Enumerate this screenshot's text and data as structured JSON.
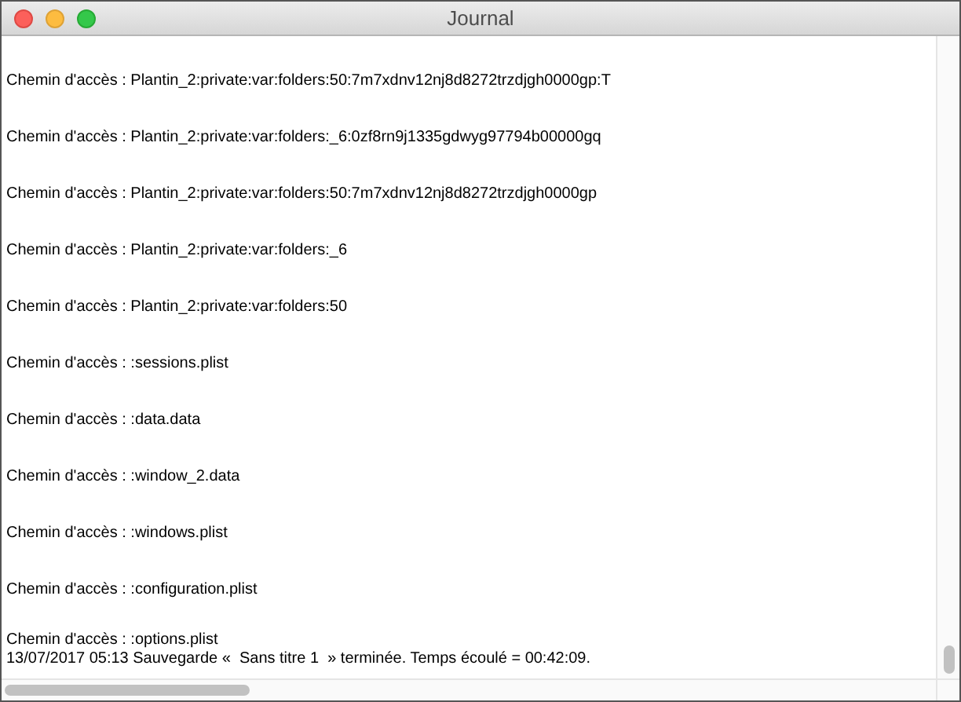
{
  "window": {
    "title": "Journal"
  },
  "log_lines": [
    "Chemin d'accès : Plantin_2:private:var:folders:50:7m7xdnv12nj8d8272trzdjgh0000gp:T",
    "Chemin d'accès : Plantin_2:private:var:folders:_6:0zf8rn9j1335gdwyg97794b00000gq",
    "Chemin d'accès : Plantin_2:private:var:folders:50:7m7xdnv12nj8d8272trzdjgh0000gp",
    "Chemin d'accès : Plantin_2:private:var:folders:_6",
    "Chemin d'accès : Plantin_2:private:var:folders:50",
    "Chemin d'accès : :sessions.plist",
    "Chemin d'accès : :data.data",
    "Chemin d'accès : :window_2.data",
    "Chemin d'accès : :windows.plist",
    "Chemin d'accès : :configuration.plist",
    "Chemin d'accès : :options.plist"
  ],
  "status_line": "13/07/2017 05:13 Sauvegarde «  Sans titre 1  » terminée. Temps écoulé = 00:42:09."
}
